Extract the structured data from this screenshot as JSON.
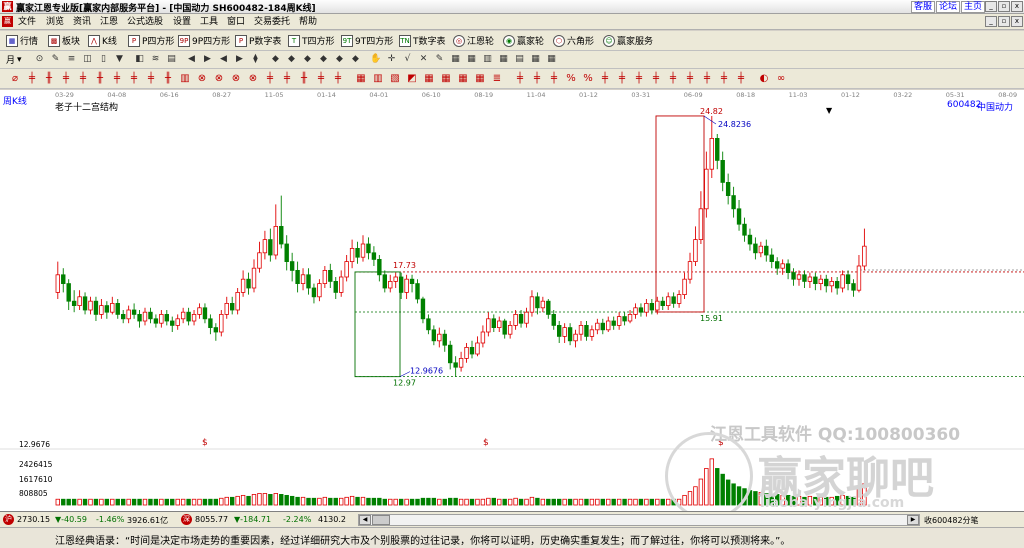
{
  "window": {
    "app_logo": "赢",
    "title": "赢家江恩专业版[赢家内部服务平台] - [中国动力  SH600482-184周K线]",
    "links": [
      "客服",
      "论坛",
      "主页"
    ],
    "controls": [
      "_",
      "▫",
      "x"
    ]
  },
  "menubar": {
    "logo": "赢",
    "items": [
      "文件",
      "浏览",
      "资讯",
      "江恩",
      "公式选股",
      "设置",
      "工具",
      "窗口",
      "交易委托",
      "帮助"
    ],
    "mdi_controls": [
      "_",
      "▫",
      "x"
    ]
  },
  "toolbar1": {
    "items": [
      {
        "icon": "grid-icon",
        "glyph": "▦",
        "label": "行情"
      },
      {
        "icon": "blocks-icon",
        "glyph": "▩",
        "label": "板块"
      },
      {
        "icon": "kline-icon",
        "glyph": "⋀",
        "label": "K线"
      },
      {
        "icon": "p-square-icon",
        "glyph": "P",
        "label": "P四方形"
      },
      {
        "icon": "9p-square-icon",
        "glyph": "9P",
        "label": "9P四方形"
      },
      {
        "icon": "p-number-icon",
        "glyph": "P",
        "label": "P数字表"
      },
      {
        "icon": "t-square-icon",
        "glyph": "T",
        "label": "T四方形"
      },
      {
        "icon": "9t-square-icon",
        "glyph": "9T",
        "label": "9T四方形"
      },
      {
        "icon": "t-number-icon",
        "glyph": "TN",
        "label": "T数字表"
      },
      {
        "icon": "gann-wheel-icon",
        "glyph": "◎",
        "label": "江恩轮"
      },
      {
        "icon": "winner-wheel-icon",
        "glyph": "◉",
        "label": "赢家轮"
      },
      {
        "icon": "hexagon-icon",
        "glyph": "⬡",
        "label": "六角形"
      },
      {
        "icon": "service-icon",
        "glyph": "☺",
        "label": "赢家服务"
      }
    ]
  },
  "toolbar2": {
    "period_label": "月",
    "period_arrow": "▾",
    "glyphs": [
      "⊙",
      "✎",
      "≡",
      "◫",
      "▯",
      "▼",
      "◧",
      "≋",
      "▤",
      "◀",
      "▶",
      "◀",
      "▶",
      "⧫",
      "◆",
      "◆",
      "◆",
      "◆",
      "◆",
      "◆",
      "✋",
      "✛",
      "√",
      "✕",
      "✎",
      "▦",
      "▦",
      "▥",
      "▦",
      "▤",
      "▦",
      "▦"
    ]
  },
  "toolbar3": {
    "glyphs": [
      "⌀",
      "╪",
      "╫",
      "╪",
      "╪",
      "╫",
      "╪",
      "╪",
      "╪",
      "╫",
      "▥",
      "⊗",
      "⊗",
      "⊗",
      "⊗",
      "╪",
      "╪",
      "╫",
      "╪",
      "╪",
      "▦",
      "▥",
      "▧",
      "◩",
      "▦",
      "▦",
      "▦",
      "▦",
      "≣",
      "╪",
      "╪",
      "╪",
      "%",
      "%",
      "╪",
      "╪",
      "╪",
      "╪",
      "╪",
      "╪",
      "╪",
      "╪",
      "╪",
      "◐",
      "∞"
    ]
  },
  "chart": {
    "panel_label": "周K线",
    "title": "老子十二宫结构",
    "stock_code": "600482",
    "stock_name": "中国动力",
    "marker_down": "▼",
    "dollar_sign": "$",
    "watermarks": {
      "company": "江恩工具软件  QQ:100800360",
      "brand": "赢家聊吧",
      "site": "liaoba.yingjia.com"
    },
    "volume_axis_labels": [
      "12.9676",
      "2426415",
      "1617610",
      "808805"
    ]
  },
  "chart_data": {
    "type": "candlestick",
    "title": "老子十二宫结构",
    "period": "周K线",
    "symbol": "600482",
    "name": "中国动力",
    "date_axis_labels": [
      "03-29",
      "04-08",
      "06-16",
      "08-27",
      "11-05",
      "01-14",
      "04-01",
      "06-10",
      "08-19",
      "11-04",
      "01-12",
      "03-31",
      "06-09",
      "08-18",
      "11-03",
      "01-12",
      "03-22",
      "05-31",
      "08-09"
    ],
    "price_range": [
      11.0,
      26.0
    ],
    "annotations": [
      {
        "text": "24.82",
        "value": 24.82,
        "color": "#c00000"
      },
      {
        "text": "24.8236",
        "value": 24.8236,
        "color": "#0000c0"
      },
      {
        "text": "17.73",
        "value": 17.73,
        "color": "#c00000"
      },
      {
        "text": "15.91",
        "value": 15.91,
        "color": "#007000"
      },
      {
        "text": "12.9676",
        "value": 12.9676,
        "color": "#0000c0"
      },
      {
        "text": "12.97",
        "value": 12.97,
        "color": "#007000"
      }
    ],
    "reference_lines": [
      {
        "value": 17.73,
        "color": "#c00000",
        "style": "dashed"
      },
      {
        "value": 15.91,
        "color": "#007000",
        "style": "dashed"
      },
      {
        "value": 12.97,
        "color": "#007000",
        "style": "dashed"
      }
    ],
    "volume_axis": [
      2426415,
      1617610,
      808805
    ],
    "candles": [
      [
        16.8,
        17.6,
        18.2,
        16.5
      ],
      [
        17.6,
        17.2,
        17.9,
        16.8
      ],
      [
        17.2,
        16.4,
        17.4,
        16.0
      ],
      [
        16.4,
        16.2,
        16.9,
        15.9
      ],
      [
        16.2,
        16.6,
        16.9,
        16.0
      ],
      [
        16.6,
        16.0,
        16.8,
        15.8
      ],
      [
        16.0,
        16.4,
        16.6,
        15.8
      ],
      [
        16.4,
        15.8,
        16.6,
        15.5
      ],
      [
        15.8,
        16.2,
        16.5,
        15.6
      ],
      [
        16.2,
        15.9,
        16.4,
        15.6
      ],
      [
        15.9,
        16.3,
        16.6,
        15.8
      ],
      [
        16.3,
        15.8,
        16.5,
        15.6
      ],
      [
        15.8,
        15.6,
        16.0,
        15.4
      ],
      [
        15.6,
        16.0,
        16.2,
        15.4
      ],
      [
        16.0,
        15.8,
        16.3,
        15.6
      ],
      [
        15.8,
        15.5,
        16.0,
        15.2
      ],
      [
        15.5,
        15.9,
        16.1,
        15.3
      ],
      [
        15.9,
        15.6,
        16.1,
        15.4
      ],
      [
        15.6,
        15.4,
        15.8,
        15.2
      ],
      [
        15.4,
        15.8,
        16.0,
        15.2
      ],
      [
        15.8,
        15.5,
        16.0,
        15.3
      ],
      [
        15.5,
        15.3,
        15.7,
        15.0
      ],
      [
        15.3,
        15.6,
        15.8,
        15.1
      ],
      [
        15.6,
        15.9,
        16.1,
        15.4
      ],
      [
        15.9,
        15.5,
        16.1,
        15.3
      ],
      [
        15.5,
        15.8,
        16.0,
        15.3
      ],
      [
        15.8,
        16.1,
        16.3,
        15.6
      ],
      [
        16.1,
        15.6,
        16.3,
        15.4
      ],
      [
        15.6,
        15.2,
        15.8,
        14.9
      ],
      [
        15.2,
        15.0,
        15.4,
        14.6
      ],
      [
        15.0,
        15.8,
        16.0,
        14.8
      ],
      [
        15.8,
        16.3,
        16.6,
        15.6
      ],
      [
        16.3,
        16.0,
        16.6,
        15.8
      ],
      [
        16.0,
        16.8,
        17.0,
        15.8
      ],
      [
        16.8,
        17.4,
        17.8,
        16.6
      ],
      [
        17.4,
        17.0,
        17.7,
        16.7
      ],
      [
        17.0,
        17.9,
        18.3,
        16.8
      ],
      [
        17.9,
        18.6,
        19.1,
        17.7
      ],
      [
        18.6,
        19.2,
        19.6,
        18.3
      ],
      [
        19.2,
        18.5,
        19.7,
        18.2
      ],
      [
        18.5,
        19.8,
        20.8,
        18.3
      ],
      [
        19.8,
        19.0,
        21.2,
        18.8
      ],
      [
        19.0,
        18.2,
        19.4,
        17.8
      ],
      [
        18.2,
        17.8,
        18.6,
        17.3
      ],
      [
        17.8,
        17.2,
        18.2,
        16.8
      ],
      [
        17.2,
        17.6,
        17.9,
        16.9
      ],
      [
        17.6,
        17.0,
        17.9,
        16.7
      ],
      [
        17.0,
        16.6,
        17.2,
        16.3
      ],
      [
        16.6,
        17.2,
        17.4,
        16.4
      ],
      [
        17.2,
        17.8,
        18.0,
        17.0
      ],
      [
        17.8,
        17.3,
        18.1,
        17.0
      ],
      [
        17.3,
        16.8,
        17.5,
        16.5
      ],
      [
        16.8,
        17.5,
        17.8,
        16.6
      ],
      [
        17.5,
        18.2,
        18.5,
        17.3
      ],
      [
        18.2,
        18.8,
        19.2,
        17.9
      ],
      [
        18.8,
        18.4,
        19.1,
        18.1
      ],
      [
        18.4,
        19.0,
        19.4,
        18.2
      ],
      [
        19.0,
        18.6,
        19.3,
        18.3
      ],
      [
        18.6,
        18.3,
        18.9,
        18.0
      ],
      [
        18.3,
        17.6,
        18.5,
        17.3
      ],
      [
        17.6,
        17.0,
        17.8,
        16.8
      ],
      [
        17.0,
        17.3,
        17.6,
        16.8
      ],
      [
        17.3,
        17.5,
        17.7,
        17.0
      ],
      [
        17.5,
        16.8,
        17.7,
        16.5
      ],
      [
        16.8,
        17.4,
        17.6,
        16.5
      ],
      [
        17.4,
        17.2,
        17.6,
        16.8
      ],
      [
        17.2,
        16.5,
        17.4,
        16.3
      ],
      [
        16.5,
        15.6,
        16.6,
        15.4
      ],
      [
        15.6,
        15.1,
        15.8,
        14.9
      ],
      [
        15.1,
        14.6,
        15.3,
        14.4
      ],
      [
        14.6,
        14.9,
        15.2,
        14.3
      ],
      [
        14.9,
        14.4,
        15.1,
        14.1
      ],
      [
        14.4,
        13.6,
        14.6,
        13.3
      ],
      [
        13.6,
        13.4,
        13.9,
        12.97
      ],
      [
        13.4,
        13.8,
        14.1,
        13.2
      ],
      [
        13.8,
        14.3,
        14.5,
        13.6
      ],
      [
        14.3,
        14.0,
        14.6,
        13.8
      ],
      [
        14.0,
        14.5,
        14.8,
        13.9
      ],
      [
        14.5,
        15.0,
        15.3,
        14.3
      ],
      [
        15.0,
        15.6,
        15.9,
        14.8
      ],
      [
        15.6,
        15.2,
        15.8,
        15.0
      ],
      [
        15.2,
        15.5,
        15.7,
        15.0
      ],
      [
        15.5,
        14.9,
        15.6,
        14.7
      ],
      [
        14.9,
        15.3,
        15.5,
        14.7
      ],
      [
        15.3,
        15.8,
        16.0,
        15.1
      ],
      [
        15.8,
        15.4,
        16.0,
        15.2
      ],
      [
        15.4,
        15.9,
        16.1,
        15.2
      ],
      [
        15.9,
        16.6,
        16.9,
        15.7
      ],
      [
        16.6,
        16.1,
        16.8,
        15.8
      ],
      [
        16.1,
        16.4,
        16.6,
        15.9
      ],
      [
        16.4,
        15.8,
        16.5,
        15.6
      ],
      [
        15.8,
        15.3,
        16.0,
        15.1
      ],
      [
        15.3,
        14.8,
        15.5,
        14.5
      ],
      [
        14.8,
        15.2,
        15.4,
        14.5
      ],
      [
        15.2,
        14.6,
        15.4,
        14.4
      ],
      [
        14.6,
        14.9,
        15.1,
        14.3
      ],
      [
        14.9,
        15.3,
        15.5,
        14.6
      ],
      [
        15.3,
        14.8,
        15.5,
        14.6
      ],
      [
        14.8,
        15.1,
        15.3,
        14.6
      ],
      [
        15.1,
        15.4,
        15.6,
        14.9
      ],
      [
        15.4,
        15.1,
        15.6,
        14.9
      ],
      [
        15.1,
        15.5,
        15.7,
        15.0
      ],
      [
        15.5,
        15.3,
        15.7,
        15.1
      ],
      [
        15.3,
        15.7,
        15.9,
        15.1
      ],
      [
        15.7,
        15.5,
        15.9,
        15.3
      ],
      [
        15.5,
        15.8,
        16.0,
        15.4
      ],
      [
        15.8,
        16.1,
        16.3,
        15.6
      ],
      [
        16.1,
        15.9,
        16.3,
        15.7
      ],
      [
        15.9,
        16.3,
        16.5,
        15.7
      ],
      [
        16.3,
        16.0,
        16.5,
        15.8
      ],
      [
        16.0,
        16.4,
        16.6,
        15.8
      ],
      [
        16.4,
        16.2,
        16.6,
        16.0
      ],
      [
        16.2,
        16.6,
        16.8,
        16.0
      ],
      [
        16.6,
        16.3,
        16.8,
        16.1
      ],
      [
        16.3,
        16.7,
        16.9,
        16.1
      ],
      [
        16.7,
        17.4,
        17.7,
        16.5
      ],
      [
        17.4,
        18.2,
        18.6,
        17.2
      ],
      [
        18.2,
        19.2,
        19.8,
        18.0
      ],
      [
        19.2,
        20.6,
        21.4,
        19.0
      ],
      [
        20.6,
        22.4,
        23.2,
        20.2
      ],
      [
        22.4,
        23.8,
        24.82,
        22.0
      ],
      [
        23.8,
        22.8,
        24.0,
        22.4
      ],
      [
        22.8,
        21.8,
        23.2,
        21.4
      ],
      [
        21.8,
        21.2,
        22.2,
        20.8
      ],
      [
        21.2,
        20.6,
        21.6,
        20.2
      ],
      [
        20.6,
        19.9,
        21.0,
        19.6
      ],
      [
        19.9,
        19.4,
        20.2,
        19.1
      ],
      [
        19.4,
        19.0,
        19.7,
        18.7
      ],
      [
        19.0,
        18.6,
        19.3,
        18.3
      ],
      [
        18.6,
        18.9,
        19.1,
        18.4
      ],
      [
        18.9,
        18.5,
        19.2,
        18.2
      ],
      [
        18.5,
        18.2,
        18.8,
        17.9
      ],
      [
        18.2,
        17.9,
        18.4,
        17.6
      ],
      [
        17.9,
        18.1,
        18.3,
        17.6
      ],
      [
        18.1,
        17.7,
        18.3,
        17.4
      ],
      [
        17.7,
        17.4,
        17.9,
        17.1
      ],
      [
        17.4,
        17.6,
        17.8,
        17.1
      ],
      [
        17.6,
        17.3,
        17.8,
        17.0
      ],
      [
        17.3,
        17.5,
        17.7,
        17.0
      ],
      [
        17.5,
        17.2,
        17.7,
        16.9
      ],
      [
        17.2,
        17.4,
        17.6,
        16.9
      ],
      [
        17.4,
        17.1,
        17.6,
        16.8
      ],
      [
        17.1,
        17.3,
        17.5,
        16.8
      ],
      [
        17.3,
        17.0,
        17.5,
        16.7
      ],
      [
        17.0,
        17.6,
        17.8,
        16.8
      ],
      [
        17.6,
        17.2,
        17.8,
        16.9
      ],
      [
        17.2,
        16.9,
        17.4,
        16.6
      ],
      [
        16.9,
        18.0,
        18.5,
        16.8
      ],
      [
        18.0,
        18.9,
        19.7,
        17.8
      ]
    ],
    "volumes": [
      0.3,
      0.3,
      0.3,
      0.3,
      0.3,
      0.3,
      0.3,
      0.3,
      0.3,
      0.3,
      0.3,
      0.3,
      0.3,
      0.3,
      0.3,
      0.3,
      0.3,
      0.3,
      0.3,
      0.3,
      0.3,
      0.3,
      0.3,
      0.3,
      0.3,
      0.3,
      0.3,
      0.3,
      0.3,
      0.3,
      0.35,
      0.4,
      0.4,
      0.45,
      0.5,
      0.45,
      0.55,
      0.6,
      0.6,
      0.55,
      0.6,
      0.55,
      0.5,
      0.45,
      0.4,
      0.4,
      0.35,
      0.35,
      0.35,
      0.4,
      0.35,
      0.35,
      0.35,
      0.4,
      0.45,
      0.4,
      0.4,
      0.35,
      0.35,
      0.35,
      0.3,
      0.3,
      0.3,
      0.3,
      0.3,
      0.3,
      0.3,
      0.35,
      0.35,
      0.35,
      0.3,
      0.3,
      0.35,
      0.35,
      0.3,
      0.3,
      0.3,
      0.3,
      0.3,
      0.35,
      0.35,
      0.3,
      0.3,
      0.3,
      0.35,
      0.3,
      0.3,
      0.4,
      0.35,
      0.3,
      0.3,
      0.3,
      0.3,
      0.3,
      0.3,
      0.3,
      0.3,
      0.3,
      0.3,
      0.3,
      0.3,
      0.3,
      0.3,
      0.3,
      0.3,
      0.3,
      0.3,
      0.3,
      0.3,
      0.3,
      0.3,
      0.3,
      0.3,
      0.3,
      0.3,
      0.5,
      0.7,
      0.95,
      1.35,
      1.9,
      2.4,
      1.9,
      1.6,
      1.3,
      1.1,
      0.95,
      0.85,
      0.75,
      0.7,
      0.65,
      0.6,
      0.55,
      0.55,
      0.5,
      0.5,
      0.45,
      0.45,
      0.4,
      0.45,
      0.4,
      0.4,
      0.4,
      0.4,
      0.45,
      0.5,
      0.45,
      0.4,
      0.9,
      1.1
    ]
  },
  "statusbar": {
    "sh_icon": "沪",
    "sh_index": "2730.15",
    "sh_change": "▼-40.59",
    "sh_pct": "-1.46%",
    "sh_amount": "3926.61亿",
    "sz_icon": "深",
    "sz_index": "8055.77",
    "sz_change": "▼-184.71",
    "sz_pct": "-2.24%",
    "sz_amount": "4130.2",
    "receive_text": "收600482分笔",
    "arrows": [
      "◀",
      "▶"
    ]
  },
  "quote": {
    "text": "江恩经典语录：“时间是决定市场走势的重要因素，经过详细研究大市及个别股票的过往记录，你将可以证明，历史确实重复发生；而了解过往，你将可以预测将来。”。"
  }
}
